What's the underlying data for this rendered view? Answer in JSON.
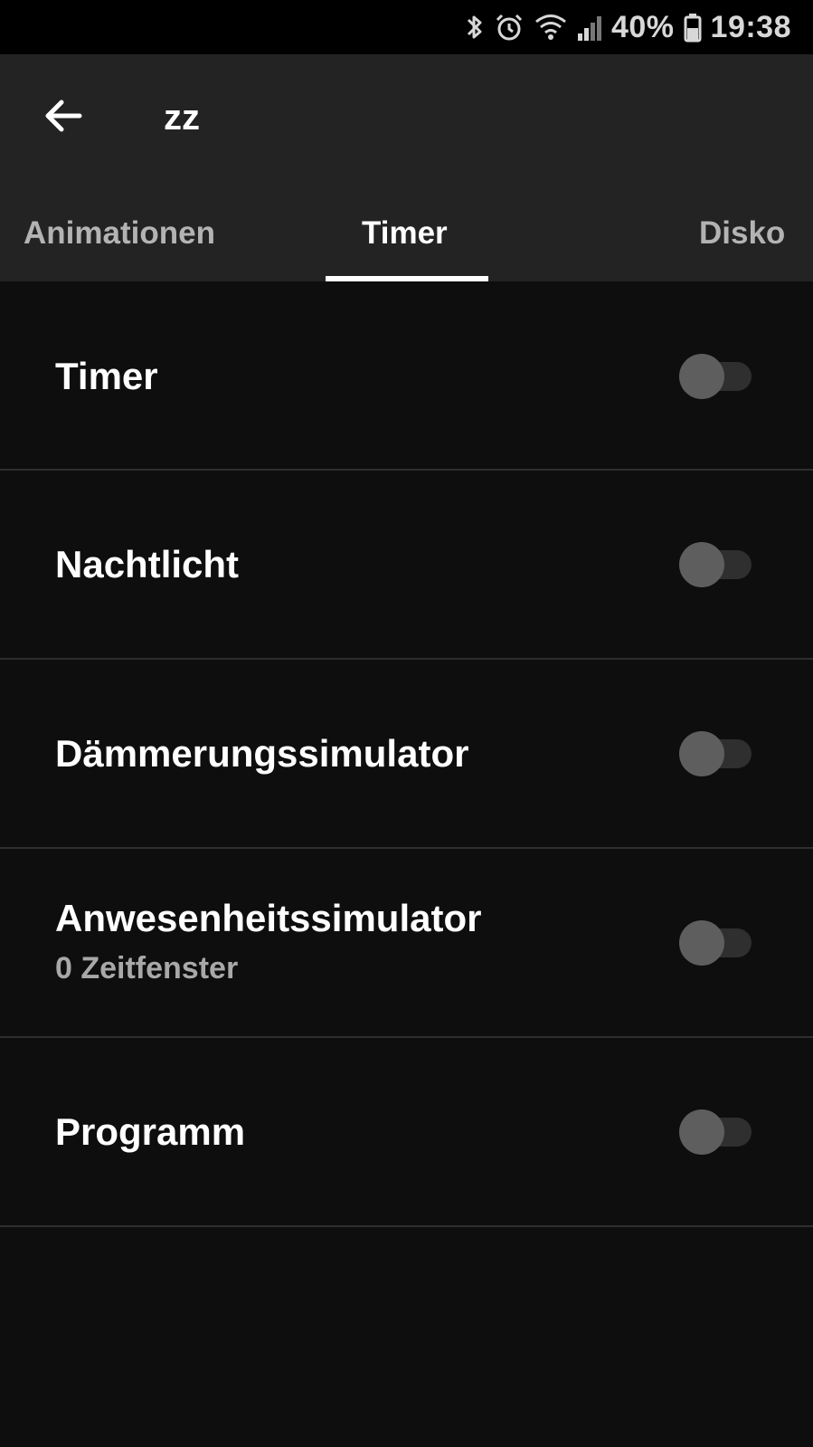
{
  "status_bar": {
    "battery_percent": "40%",
    "time": "19:38",
    "icons": [
      "bluetooth-icon",
      "alarm-icon",
      "wifi-icon",
      "signal-icon",
      "battery-icon"
    ]
  },
  "app_bar": {
    "back_icon": "arrow-left-icon",
    "title": "zz"
  },
  "tabs": [
    {
      "label": "Animationen",
      "active": false
    },
    {
      "label": "Timer",
      "active": true
    },
    {
      "label": "Disko",
      "active": false
    }
  ],
  "settings": [
    {
      "label": "Timer",
      "subtitle": "",
      "enabled": false
    },
    {
      "label": "Nachtlicht",
      "subtitle": "",
      "enabled": false
    },
    {
      "label": "Dämmerungssimulator",
      "subtitle": "",
      "enabled": false
    },
    {
      "label": "Anwesenheitssimulator",
      "subtitle": "0 Zeitfenster",
      "enabled": false
    },
    {
      "label": "Programm",
      "subtitle": "",
      "enabled": false
    }
  ],
  "colors": {
    "background": "#0e0e0e",
    "app_bar": "#232323",
    "status_bar": "#000000",
    "switch_thumb_off": "#5e5e5e",
    "switch_track_off": "#2f2f2f",
    "divider": "#2e2e2e"
  }
}
